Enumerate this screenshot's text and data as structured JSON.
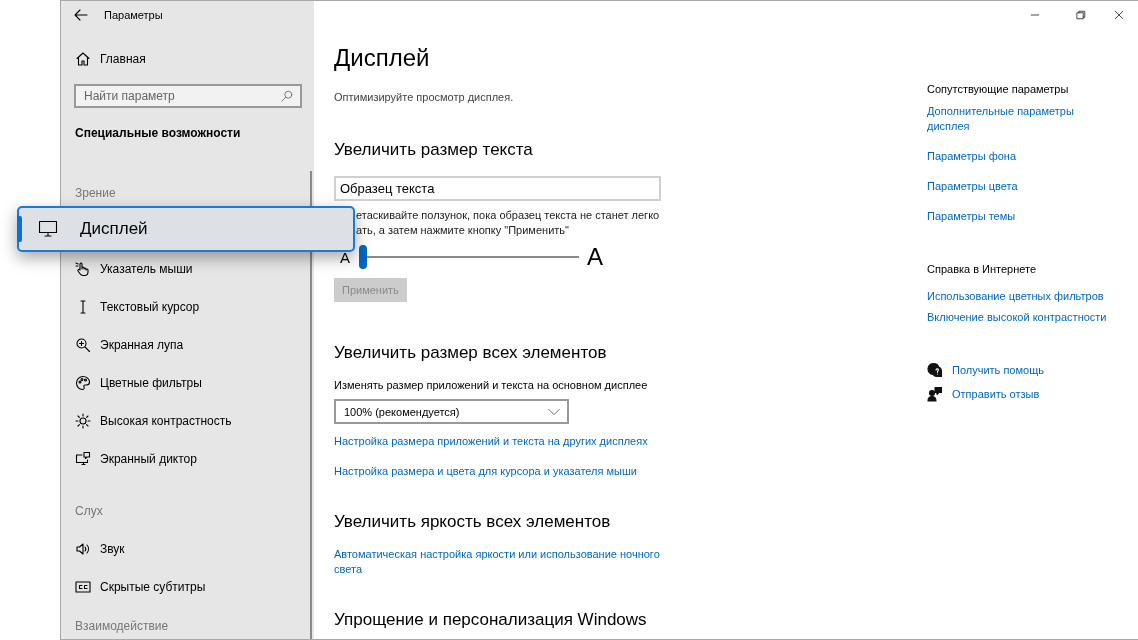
{
  "window": {
    "title": "Параметры"
  },
  "sidebar": {
    "home": "Главная",
    "search": {
      "placeholder": "Найти параметр"
    },
    "heading": "Специальные возможности",
    "sections": [
      {
        "title": "Зрение",
        "items": [
          {
            "label": "Указатель мыши",
            "kind": "pointer"
          },
          {
            "label": "Текстовый курсор",
            "kind": "cursor"
          },
          {
            "label": "Экранная лупа",
            "kind": "magnifier"
          },
          {
            "label": "Цветные фильтры",
            "kind": "palette"
          },
          {
            "label": "Высокая контрастность",
            "kind": "contrast"
          },
          {
            "label": "Экранный диктор",
            "kind": "narrator"
          }
        ]
      },
      {
        "title": "Слух",
        "items": [
          {
            "label": "Звук",
            "kind": "sound"
          },
          {
            "label": "Скрытые субтитры",
            "kind": "captions"
          }
        ]
      },
      {
        "title": "Взаимодействие"
      }
    ]
  },
  "callout": {
    "label": "Дисплей",
    "selected": true
  },
  "main": {
    "title": "Дисплей",
    "subtitle": "Оптимизируйте просмотр дисплея.",
    "sections": [
      {
        "kind": "text_size",
        "heading": "Увеличить размер текста",
        "sample": "Образец текста",
        "description": [
          "етаскивайте ползунок, пока образец текста не станет легко",
          "ать, а затем нажмите кнопку \"Применить\""
        ],
        "slider": {
          "min_label": "A",
          "max_label": "A",
          "level": 0
        },
        "button": {
          "label": "Применить",
          "disabled": true
        }
      },
      {
        "kind": "scale",
        "heading": "Увеличить размер всех элементов",
        "label": "Изменять размер приложений и текста на основном дисплее",
        "dropdown": {
          "value": "100% (рекомендуется)"
        },
        "links": [
          "Настройка размера приложений и текста на других дисплеях",
          "Настройка размера и цвета для курсора и указателя мыши"
        ]
      },
      {
        "kind": "links",
        "heading": "Увеличить яркость всех элементов",
        "links": [
          "Автоматическая настройка яркости или использование ночного света"
        ]
      },
      {
        "kind": "links",
        "heading": "Упрощение и персонализация Windows"
      }
    ]
  },
  "related": {
    "heading": "Сопутствующие параметры",
    "links": [
      "Дополнительные параметры дисплея",
      "Параметры фона",
      "Параметры цвета",
      "Параметры темы"
    ],
    "help": {
      "heading": "Справка в Интернете",
      "links": [
        "Использование цветных фильтров",
        "Включение высокой контрастности"
      ]
    },
    "actions": [
      {
        "label": "Получить помощь",
        "kind": "help"
      },
      {
        "label": "Отправить отзыв",
        "kind": "feedback"
      }
    ]
  }
}
